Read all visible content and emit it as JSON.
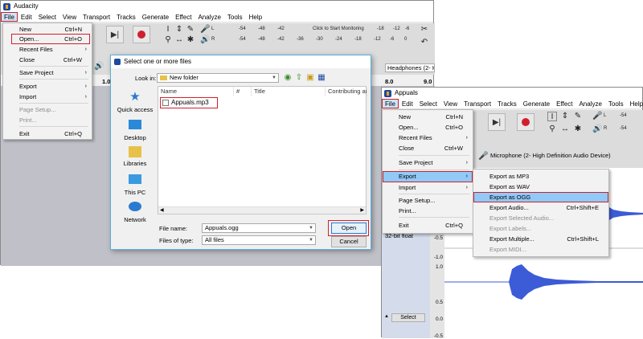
{
  "w1": {
    "title": "Audacity",
    "menus": [
      "File",
      "Edit",
      "Select",
      "View",
      "Transport",
      "Tracks",
      "Generate",
      "Effect",
      "Analyze",
      "Tools",
      "Help"
    ],
    "meter_ticks_top": [
      "-54",
      "-48",
      "-42",
      "-18",
      "-12",
      "-6",
      "0"
    ],
    "meter_click": "Click to Start Monitoring",
    "meter_ticks_bottom": [
      "-54",
      "-48",
      "-42",
      "-36",
      "-30",
      "-24",
      "-18",
      "-12",
      "-6",
      "0"
    ],
    "meter_l": "L",
    "meter_r": "R",
    "device": "Headphones (2- Hig",
    "ruler": [
      "1.0",
      "8.0",
      "9.0"
    ],
    "file_menu": [
      {
        "label": "New",
        "shortcut": "Ctrl+N"
      },
      {
        "label": "Open...",
        "shortcut": "Ctrl+O"
      },
      {
        "label": "Recent Files",
        "shortcut": ""
      },
      {
        "label": "Close",
        "shortcut": "Ctrl+W"
      },
      {
        "label": "Save Project",
        "shortcut": ""
      },
      {
        "label": "Export",
        "shortcut": ""
      },
      {
        "label": "Import",
        "shortcut": ""
      },
      {
        "label": "Page Setup...",
        "shortcut": ""
      },
      {
        "label": "Print...",
        "shortcut": ""
      },
      {
        "label": "Exit",
        "shortcut": "Ctrl+Q"
      }
    ]
  },
  "dialog": {
    "title": "Select one or more files",
    "look_in_label": "Look in:",
    "look_in_value": "New folder",
    "places": [
      "Quick access",
      "Desktop",
      "Libraries",
      "This PC",
      "Network"
    ],
    "columns": [
      "Name",
      "#",
      "Title",
      "Contributing art"
    ],
    "files": [
      "Appuals.mp3"
    ],
    "filename_label": "File name:",
    "filename_value": "Appuals.ogg",
    "filetype_label": "Files of type:",
    "filetype_value": "All files",
    "open_label": "Open",
    "cancel_label": "Cancel"
  },
  "w2": {
    "title": "Appuals",
    "menus": [
      "File",
      "Edit",
      "Select",
      "View",
      "Transport",
      "Tracks",
      "Generate",
      "Effect",
      "Analyze",
      "Tools",
      "Help"
    ],
    "meter_vals": [
      "-54",
      "-54"
    ],
    "meter_l": "L",
    "meter_r": "R",
    "device": "Microphone (2- High Definition Audio Device)",
    "track_info": "32-bit float",
    "select_label": "Select",
    "scale": [
      "-0.5",
      "-1.0",
      "1.0",
      "0.5",
      "0.0",
      "-0.5"
    ],
    "file_menu": [
      {
        "label": "New",
        "shortcut": "Ctrl+N"
      },
      {
        "label": "Open...",
        "shortcut": "Ctrl+O"
      },
      {
        "label": "Recent Files",
        "shortcut": ""
      },
      {
        "label": "Close",
        "shortcut": "Ctrl+W"
      },
      {
        "label": "Save Project",
        "shortcut": ""
      },
      {
        "label": "Export",
        "shortcut": ""
      },
      {
        "label": "Import",
        "shortcut": ""
      },
      {
        "label": "Page Setup...",
        "shortcut": ""
      },
      {
        "label": "Print...",
        "shortcut": ""
      },
      {
        "label": "Exit",
        "shortcut": "Ctrl+Q"
      }
    ],
    "export_menu": [
      {
        "label": "Export as MP3",
        "shortcut": ""
      },
      {
        "label": "Export as WAV",
        "shortcut": ""
      },
      {
        "label": "Export as OGG",
        "shortcut": ""
      },
      {
        "label": "Export Audio...",
        "shortcut": "Ctrl+Shift+E"
      },
      {
        "label": "Export Selected Audio...",
        "shortcut": ""
      },
      {
        "label": "Export Labels...",
        "shortcut": ""
      },
      {
        "label": "Export Multiple...",
        "shortcut": "Ctrl+Shift+L"
      },
      {
        "label": "Export MIDI...",
        "shortcut": ""
      }
    ]
  },
  "colors": {
    "highlight_red": "#d0202d",
    "menu_highlight": "#91c9f7",
    "waveform": "#3c5bd6",
    "dialog_border": "#5ab0d8"
  }
}
